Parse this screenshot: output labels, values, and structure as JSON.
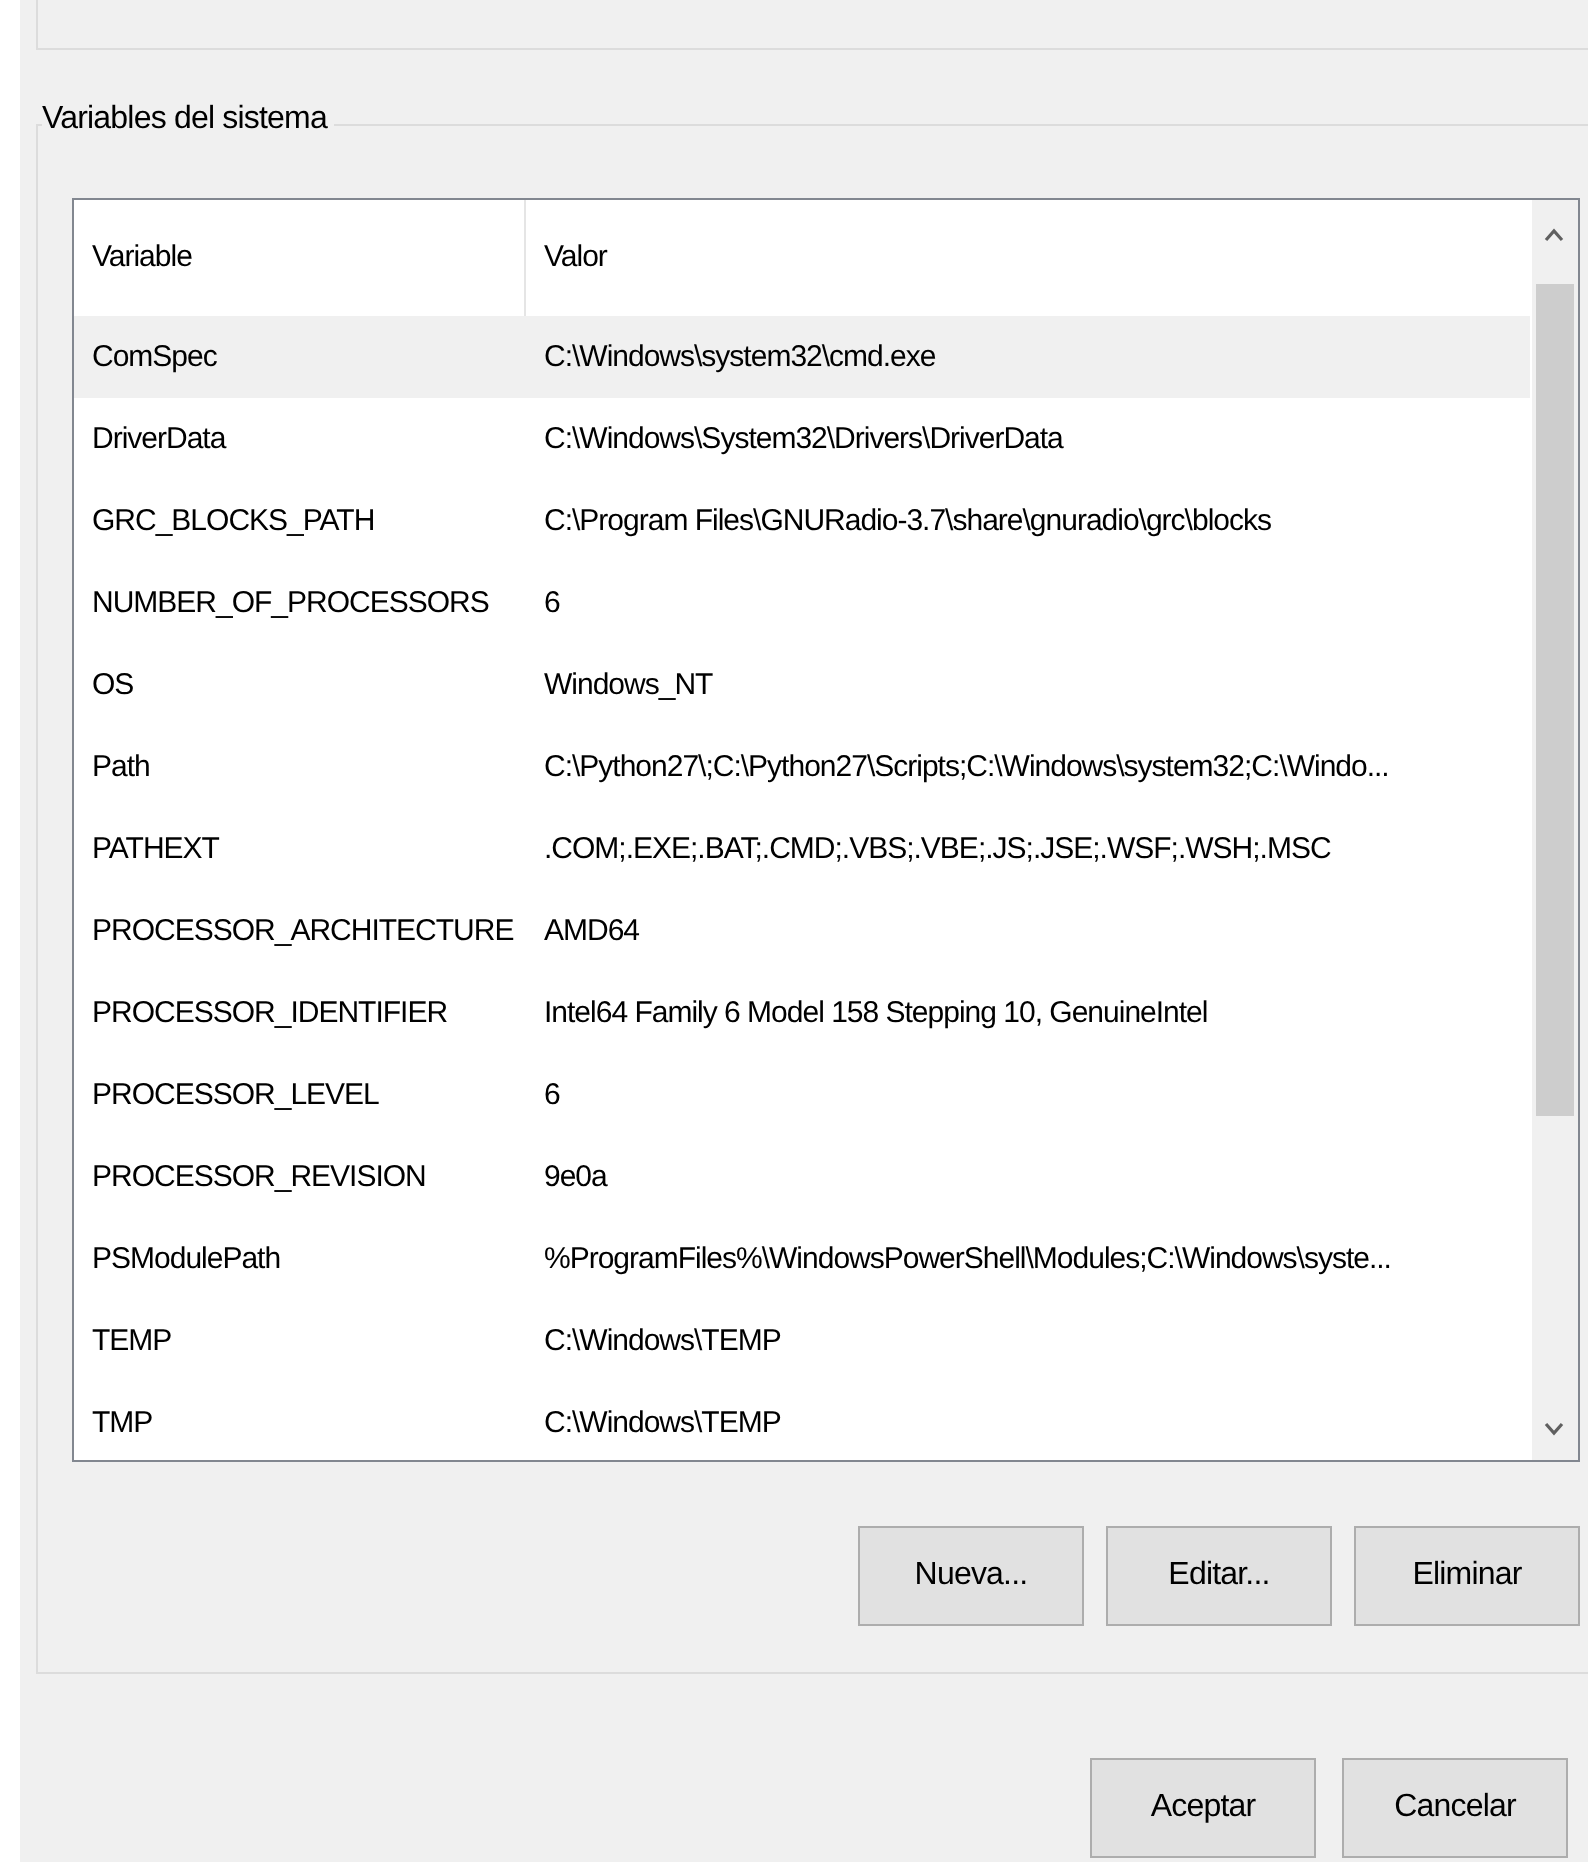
{
  "group": {
    "title": "Variables del sistema"
  },
  "table": {
    "columns": [
      "Variable",
      "Valor"
    ],
    "rows": [
      {
        "variable": "ComSpec",
        "value": "C:\\Windows\\system32\\cmd.exe",
        "selected": true
      },
      {
        "variable": "DriverData",
        "value": "C:\\Windows\\System32\\Drivers\\DriverData",
        "selected": false
      },
      {
        "variable": "GRC_BLOCKS_PATH",
        "value": "C:\\Program Files\\GNURadio-3.7\\share\\gnuradio\\grc\\blocks",
        "selected": false
      },
      {
        "variable": "NUMBER_OF_PROCESSORS",
        "value": "6",
        "selected": false
      },
      {
        "variable": "OS",
        "value": "Windows_NT",
        "selected": false
      },
      {
        "variable": "Path",
        "value": "C:\\Python27\\;C:\\Python27\\Scripts;C:\\Windows\\system32;C:\\Windo...",
        "selected": false
      },
      {
        "variable": "PATHEXT",
        "value": ".COM;.EXE;.BAT;.CMD;.VBS;.VBE;.JS;.JSE;.WSF;.WSH;.MSC",
        "selected": false
      },
      {
        "variable": "PROCESSOR_ARCHITECTURE",
        "value": "AMD64",
        "selected": false
      },
      {
        "variable": "PROCESSOR_IDENTIFIER",
        "value": "Intel64 Family 6 Model 158 Stepping 10, GenuineIntel",
        "selected": false
      },
      {
        "variable": "PROCESSOR_LEVEL",
        "value": "6",
        "selected": false
      },
      {
        "variable": "PROCESSOR_REVISION",
        "value": "9e0a",
        "selected": false
      },
      {
        "variable": "PSModulePath",
        "value": "%ProgramFiles%\\WindowsPowerShell\\Modules;C:\\Windows\\syste...",
        "selected": false
      },
      {
        "variable": "TEMP",
        "value": "C:\\Windows\\TEMP",
        "selected": false
      },
      {
        "variable": "TMP",
        "value": "C:\\Windows\\TEMP",
        "selected": false
      }
    ]
  },
  "group_buttons": [
    "Nueva...",
    "Editar...",
    "Eliminar"
  ],
  "dialog_buttons": [
    "Aceptar",
    "Cancelar"
  ]
}
